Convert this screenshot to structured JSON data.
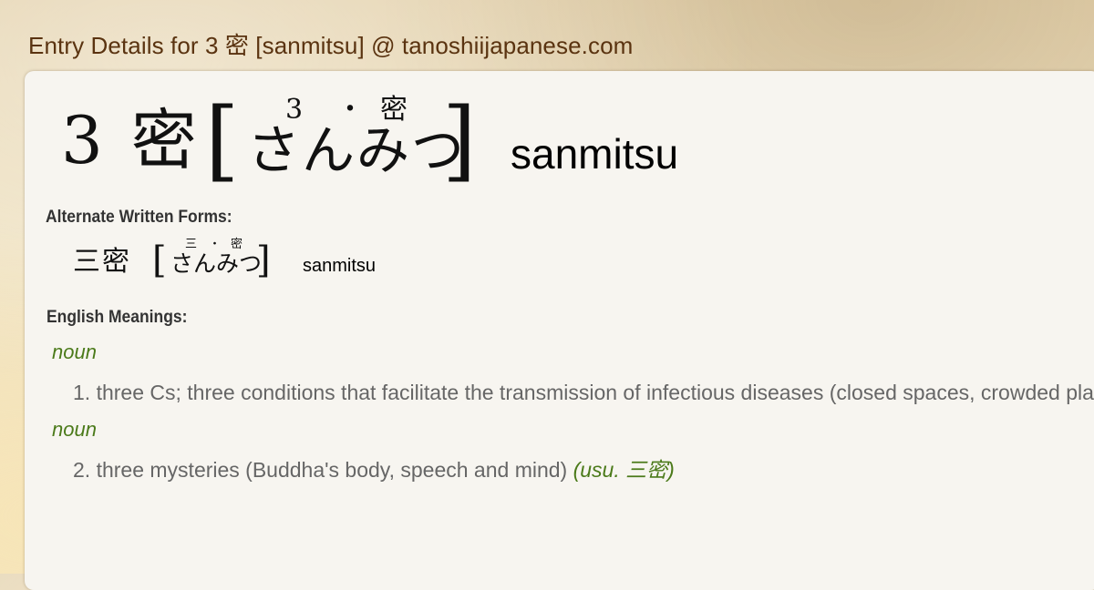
{
  "page": {
    "title": "Entry Details for  3 密 [sanmitsu] @ tanoshiijapanese.com"
  },
  "entry": {
    "kanji": "3 密",
    "bracket_open": "[",
    "bracket_close": "]",
    "furigana": [
      "3",
      "・",
      "密"
    ],
    "kana": "さんみつ",
    "romaji": "sanmitsu"
  },
  "alternate_forms": {
    "label": "Alternate Written Forms:",
    "items": [
      {
        "kanji": "三密",
        "bracket_open": "[",
        "bracket_close": "]",
        "furigana": [
          "三",
          "・",
          "密"
        ],
        "kana": "さんみつ",
        "romaji": "sanmitsu"
      }
    ]
  },
  "meanings": {
    "label": "English Meanings:",
    "items": [
      {
        "pos": "noun",
        "number": "1.",
        "text": "three Cs; three conditions that facilitate the transmission of infectious diseases (closed spaces, crowded places, close-contact settings)",
        "tag": ""
      },
      {
        "pos": "noun",
        "number": "2.",
        "text": "three mysteries (Buddha's body, speech and mind)",
        "tag_open": "(usu. ",
        "tag_cjk": "三密",
        "tag_close": ")"
      }
    ]
  },
  "colors": {
    "title": "#5a3310",
    "pos_green": "#4b7a1a",
    "meaning_gray": "#666666",
    "card_bg": "#f7f5f0",
    "page_bg": "#ecdcb8"
  }
}
